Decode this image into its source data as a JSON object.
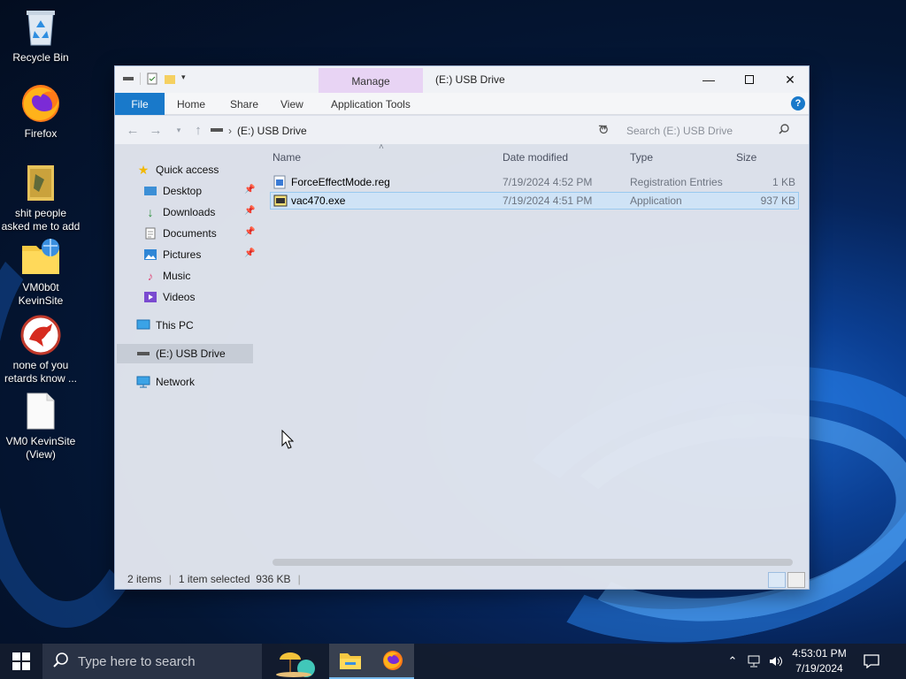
{
  "desktop": {
    "icons": [
      {
        "label": "Recycle Bin",
        "icon": "recycle-bin-icon"
      },
      {
        "label": "Firefox",
        "icon": "firefox-icon"
      },
      {
        "label": "shit people asked me to add",
        "icon": "folder-icon"
      },
      {
        "label": "VM0b0t KevinSite",
        "icon": "folder-globe-icon"
      },
      {
        "label": "none of you retards know ...",
        "icon": "dragon-app-icon"
      },
      {
        "label": "VM0 KevinSite (View)",
        "icon": "blank-file-icon"
      }
    ]
  },
  "window": {
    "title": "(E:) USB Drive",
    "contextual_tab": "Manage",
    "ribbon_tabs": [
      "File",
      "Home",
      "Share",
      "View",
      "Application Tools"
    ],
    "address": "(E:) USB Drive",
    "search_placeholder": "Search (E:) USB Drive",
    "columns": {
      "name": "Name",
      "date": "Date modified",
      "type": "Type",
      "size": "Size"
    },
    "files": [
      {
        "name": "ForceEffectMode.reg",
        "date": "7/19/2024 4:52 PM",
        "type": "Registration Entries",
        "size": "1 KB",
        "icon": "registry-file-icon",
        "selected": false
      },
      {
        "name": "vac470.exe",
        "date": "7/19/2024 4:51 PM",
        "type": "Application",
        "size": "937 KB",
        "icon": "application-exe-icon",
        "selected": true
      }
    ],
    "nav": {
      "quick_access": "Quick access",
      "quick_items": [
        "Desktop",
        "Downloads",
        "Documents",
        "Pictures",
        "Music",
        "Videos"
      ],
      "this_pc": "This PC",
      "usb": "(E:) USB Drive",
      "network": "Network"
    },
    "status": {
      "items": "2 items",
      "selection": "1 item selected  936 KB"
    }
  },
  "taskbar": {
    "search_placeholder": "Type here to search",
    "time": "4:53:01 PM",
    "date": "7/19/2024"
  },
  "colors": {
    "accent": "#1979ca",
    "selection": "#cfe3f6",
    "manage_tab": "#e8d4f4"
  }
}
